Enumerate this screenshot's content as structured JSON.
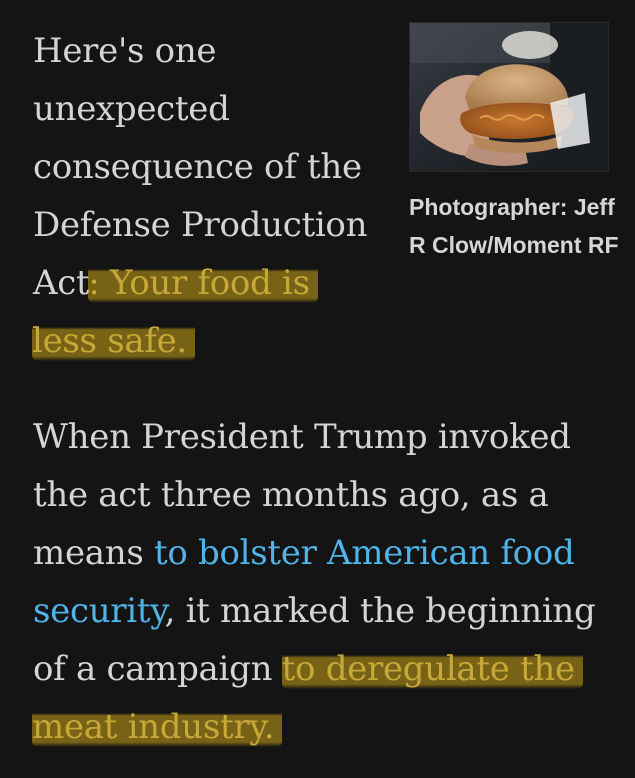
{
  "article": {
    "para1": {
      "before": "Here's one unexpected consequence of the Defense Production Act",
      "highlight": ": Your food is less safe."
    },
    "para2": {
      "part1": "When President Trump invoked the act three months ago, as a means ",
      "link1": "to bolster American food security",
      "part2": ", it marked the beginning of a campaign ",
      "highlight": "to deregulate the meat industry."
    },
    "photo": {
      "alt": "",
      "caption": "Photographer: Jeff R Clow/Moment RF"
    }
  },
  "colors": {
    "background": "#141414",
    "text": "#d4d4d4",
    "link": "#4fb4e8",
    "highlight": "#c9a317"
  }
}
